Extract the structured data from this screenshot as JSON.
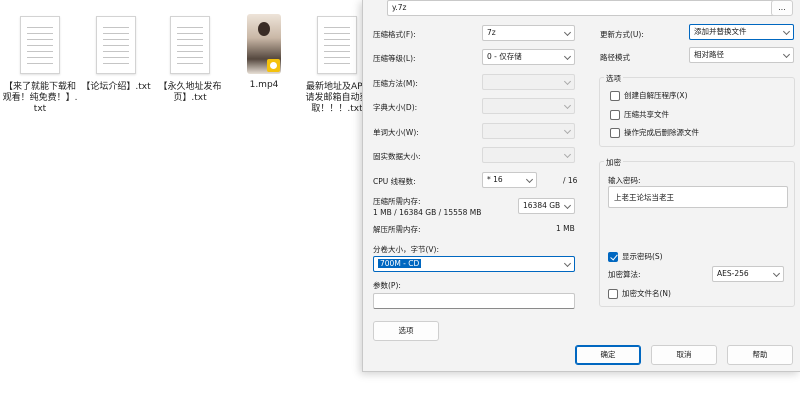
{
  "explorer": {
    "files": [
      {
        "name": "【来了就能下载和观看！纯免费！】.txt",
        "icon": "text-file-icon"
      },
      {
        "name": "【论坛介绍】.txt",
        "icon": "text-file-icon"
      },
      {
        "name": "【永久地址发布页】.txt",
        "icon": "text-file-icon"
      },
      {
        "name": "1.mp4",
        "icon": "video-thumbnail-icon"
      },
      {
        "name": "最新地址及APP请发邮箱自动获取！！！.txt",
        "icon": "text-file-icon"
      }
    ]
  },
  "dialog": {
    "archive_path": "y.7z",
    "browse_label": "...",
    "left": {
      "format_label": "压缩格式(F):",
      "format_value": "7z",
      "level_label": "压缩等级(L):",
      "level_value": "0 - 仅存储",
      "method_label": "压缩方法(M):",
      "dict_label": "字典大小(D):",
      "word_label": "单词大小(W):",
      "solid_label": "固实数据大小:",
      "cpu_label": "CPU 线程数:",
      "cpu_value": "* 16",
      "cpu_total": "/ 16",
      "mem_label": "压缩所需内存:",
      "mem_detail": "1 MB / 16384 GB / 15558 MB",
      "mem_value": "16384 GB",
      "decomp_label": "解压所需内存:",
      "decomp_value": "1 MB",
      "split_label": "分卷大小，字节(V):",
      "split_value": "700M - CD",
      "params_label": "参数(P):",
      "params_value": "",
      "options_button": "选项"
    },
    "right": {
      "update_label": "更新方式(U):",
      "update_value": "添加并替换文件",
      "path_label": "路径模式",
      "path_value": "相对路径",
      "options_group": "选项",
      "opt_sfx": "创建自解压程序(X)",
      "opt_shared": "压缩共享文件",
      "opt_delete": "操作完成后删除源文件",
      "encrypt_group": "加密",
      "password_label": "输入密码:",
      "password_value": "上老王论坛当老王",
      "show_password": "显示密码(S)",
      "enc_method_label": "加密算法:",
      "enc_method_value": "AES-256",
      "encrypt_names": "加密文件名(N)"
    },
    "buttons": {
      "ok": "确定",
      "cancel": "取消",
      "help": "帮助"
    }
  }
}
